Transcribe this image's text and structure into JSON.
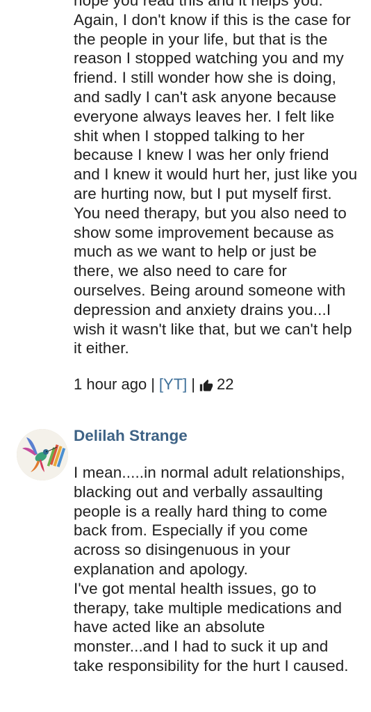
{
  "comments": [
    {
      "body": "hope you read this and it helps you.\nAgain, I don't know if this is the case for the people in your life, but that is the reason I stopped watching you and my friend. I still wonder how she is doing, and sadly I can't ask anyone because everyone always leaves her. I felt like shit when I stopped talking to her because I knew I was her only friend and I knew it would hurt her, just like you are hurting now, but I put myself first. You need therapy, but you also need to show some improvement because as much as we want to help or just be there, we also need to care for ourselves. Being around someone with depression and anxiety drains you...I wish it wasn't like that, but we can't help it either.",
      "timestamp": "1 hour ago",
      "separator": "|",
      "source_link": "[YT]",
      "like_icon": "thumbs-up-icon",
      "likes": "22"
    },
    {
      "author": "Delilah Strange",
      "avatar_icon": "hummingbird-avatar",
      "body": "I mean.....in normal adult relationships, blacking out and verbally assaulting people is a really hard thing to come back from. Especially if you come across so disingenuous in your explanation and apology.\nI've got mental health issues, go to therapy, take multiple medications and have acted like an absolute monster...and I had to suck it up and take responsibility for the hurt I caused."
    }
  ],
  "colors": {
    "author_name": "#3d6285",
    "link": "#3d6f99",
    "text": "#1f1f1f",
    "background": "#ffffff"
  }
}
